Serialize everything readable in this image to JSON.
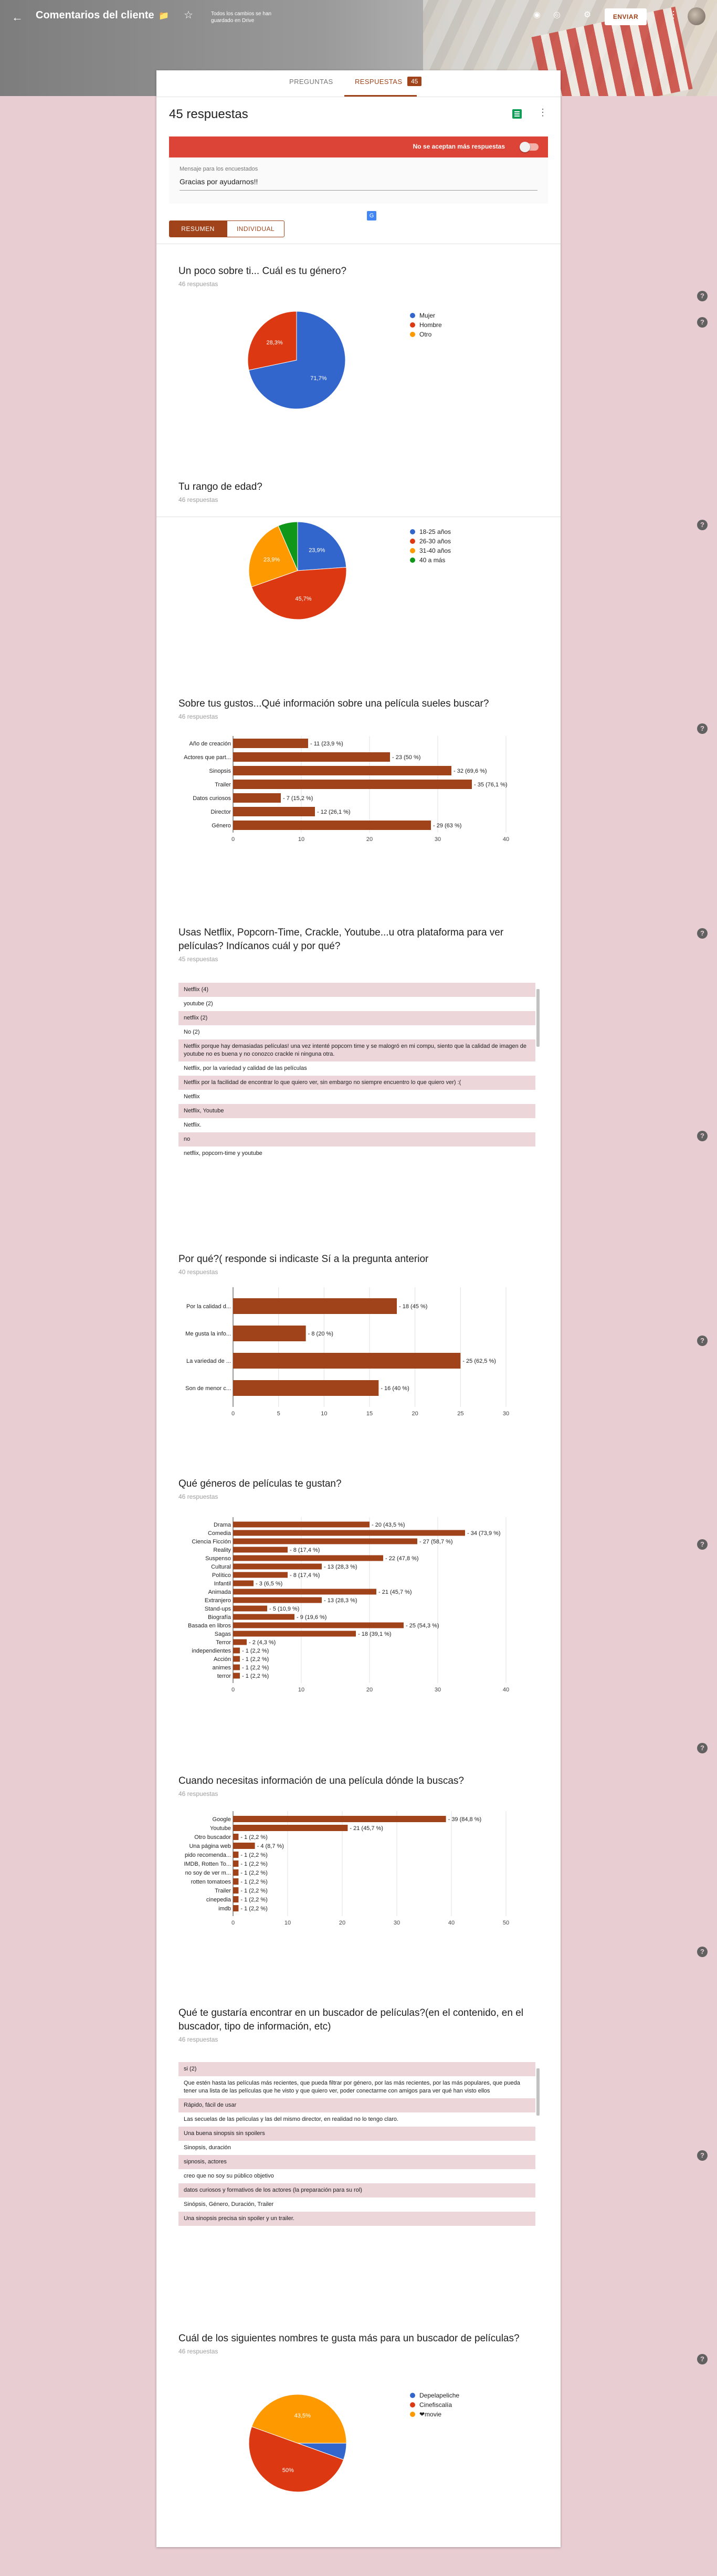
{
  "header": {
    "back_icon": "arrow-back-icon",
    "title": "Comentarios del cliente",
    "save_status": "Todos los cambios se han guardado en Drive",
    "send_label": "ENVIAR"
  },
  "tabs": {
    "preguntas": "PREGUNTAS",
    "respuestas": "RESPUESTAS",
    "badge": "45"
  },
  "summary": {
    "count_label": "45 respuestas",
    "accepting_label": "No se aceptan más respuestas",
    "message_label": "Mensaje para los encuestados",
    "message_value": "Gracias por ayudarnos!!",
    "resumen_label": "RESUMEN",
    "individual_label": "INDIVIDUAL"
  },
  "colors": {
    "accent": "#a0431a",
    "blue": "#3366cc",
    "red": "#dc3912",
    "orange": "#ff9900",
    "green": "#109618",
    "bar": "#a0431a"
  },
  "questions": {
    "q1": {
      "title": "Un poco sobre ti... Cuál es tu género?",
      "count": "46 respuestas"
    },
    "q2": {
      "title": "Tu rango de edad?",
      "count": "46 respuestas"
    },
    "q3": {
      "title": "Sobre tus gustos...Qué información sobre una película sueles buscar?",
      "count": "46 respuestas"
    },
    "q4": {
      "title": "Usas Netflix, Popcorn-Time, Crackle, Youtube...u otra plataforma para ver películas? Indícanos cuál y por qué?",
      "count": "45 respuestas"
    },
    "q5": {
      "title": "Por qué?( responde si indicaste Sí a la pregunta anterior",
      "count": "40 respuestas"
    },
    "q6": {
      "title": "Qué géneros de películas te gustan?",
      "count": "46 respuestas"
    },
    "q7": {
      "title": "Cuando necesitas información de una película dónde la buscas?",
      "count": "46 respuestas"
    },
    "q8": {
      "title": "Qué te gustaría encontrar en un buscador de películas?(en el contenido, en el buscador, tipo de información, etc)",
      "count": "46 respuestas"
    },
    "q9": {
      "title": "Cuál de los siguientes nombres te gusta más para un buscador de películas?",
      "count": "46 respuestas"
    }
  },
  "q4_responses": [
    "Netflix (4)",
    "youtube (2)",
    "netflix (2)",
    "No (2)",
    "Netflix porque hay demasiadas películas! una vez intenté popcorn time y se malogró en mi compu, siento que la calidad de imagen de youtube no es buena y no conozco crackle ni ninguna otra.",
    "Netflix, por la variedad y calidad de las películas",
    "Netflix por la facilidad de encontrar lo que quiero ver, sin embargo no siempre encuentro lo que quiero ver) :(",
    "Netflix",
    "Netflix, Youtube",
    "Netflix.",
    "no",
    "netflix, popcorn-time y youtube"
  ],
  "q8_responses": [
    "si (2)",
    "Que estén hasta las películas más recientes, que pueda filtrar por género, por las más recientes, por las más populares, que pueda tener una lista de las películas que he visto y que quiero ver, poder conectarme con amigos para ver qué han visto ellos",
    "Rápido, fácil de usar",
    "Las secuelas de las películas y las del mismo director, en realidad no lo tengo claro.",
    "Una buena sinopsis sin spoilers",
    "Sinopsis, duración",
    "sipnosis, actores",
    "creo que no soy su público objetivo",
    "datos curiosos y formativos de los actores (la preparación para su rol)",
    "Sinópsis, Género, Duración, Trailer",
    "Una sinopsis precisa sin spoiler y un trailer."
  ],
  "chart_data": [
    {
      "type": "pie",
      "categories": [
        "Mujer",
        "Hombre",
        "Otro"
      ],
      "values": [
        71.7,
        28.3,
        0
      ],
      "slice_labels": [
        "71,7%",
        "28,3%",
        ""
      ],
      "colors": [
        "#3366cc",
        "#dc3912",
        "#ff9900"
      ],
      "legend": "right"
    },
    {
      "type": "pie",
      "categories": [
        "18-25 años",
        "26-30 años",
        "31-40 años",
        "40 a más"
      ],
      "values": [
        23.9,
        45.7,
        23.9,
        6.5
      ],
      "slice_labels": [
        "23,9%",
        "45,7%",
        "23,9%",
        ""
      ],
      "colors": [
        "#3366cc",
        "#dc3912",
        "#ff9900",
        "#109618"
      ],
      "legend": "right"
    },
    {
      "type": "bar",
      "orientation": "horizontal",
      "categories": [
        "Año de creación",
        "Actores que part...",
        "Sinopsis",
        "Trailer",
        "Datos curiosos",
        "Director",
        "Género"
      ],
      "values": [
        11,
        23,
        32,
        35,
        7,
        12,
        29
      ],
      "value_labels": [
        "11 (23,9 %)",
        "23 (50 %)",
        "32 (69,6 %)",
        "35 (76,1 %)",
        "7 (15,2 %)",
        "12 (26,1 %)",
        "29 (63 %)"
      ],
      "xlim": [
        0,
        40
      ],
      "ticks": [
        0,
        10,
        20,
        30,
        40
      ]
    },
    {
      "type": "bar",
      "orientation": "horizontal",
      "categories": [
        "Por la calidad d...",
        "Me gusta la info...",
        "La variedad de ...",
        "Son de menor c..."
      ],
      "values": [
        18,
        8,
        25,
        16
      ],
      "value_labels": [
        "18 (45 %)",
        "8 (20 %)",
        "25 (62,5 %)",
        "16 (40 %)"
      ],
      "xlim": [
        0,
        30
      ],
      "ticks": [
        0,
        5,
        10,
        15,
        20,
        25,
        30
      ]
    },
    {
      "type": "bar",
      "orientation": "horizontal",
      "categories": [
        "Drama",
        "Comedia",
        "Ciencia Ficción",
        "Reality",
        "Suspenso",
        "Cultural",
        "Político",
        "Infantil",
        "Animada",
        "Extranjero",
        "Stand-ups",
        "Biografía",
        "Basada en libros",
        "Sagas",
        "Terror",
        "independientes",
        "Acción",
        "animes",
        "terror"
      ],
      "values": [
        20,
        34,
        27,
        8,
        22,
        13,
        8,
        3,
        21,
        13,
        5,
        9,
        25,
        18,
        2,
        1,
        1,
        1,
        1
      ],
      "value_labels": [
        "20 (43,5 %)",
        "34 (73,9 %)",
        "27 (58,7 %)",
        "8 (17,4 %)",
        "22 (47,8 %)",
        "13 (28,3 %)",
        "8 (17,4 %)",
        "3 (6,5 %)",
        "21 (45,7 %)",
        "13 (28,3 %)",
        "5 (10,9 %)",
        "9 (19,6 %)",
        "25 (54,3 %)",
        "18 (39,1 %)",
        "2 (4,3 %)",
        "1 (2,2 %)",
        "1 (2,2 %)",
        "1 (2,2 %)",
        "1 (2,2 %)"
      ],
      "xlim": [
        0,
        40
      ],
      "ticks": [
        0,
        10,
        20,
        30,
        40
      ]
    },
    {
      "type": "bar",
      "orientation": "horizontal",
      "categories": [
        "Google",
        "Youtube",
        "Otro buscador",
        "Una página web",
        "pido recomenda...",
        "IMDB, Rotten To...",
        "no soy de ver m...",
        "rotten tomatoes",
        "Trailer",
        "cinepedia",
        "imdb"
      ],
      "values": [
        39,
        21,
        1,
        4,
        1,
        1,
        1,
        1,
        1,
        1,
        1
      ],
      "value_labels": [
        "39 (84,8 %)",
        "21 (45,7 %)",
        "1 (2,2 %)",
        "4 (8,7 %)",
        "1 (2,2 %)",
        "1 (2,2 %)",
        "1 (2,2 %)",
        "1 (2,2 %)",
        "1 (2,2 %)",
        "1 (2,2 %)",
        "1 (2,2 %)"
      ],
      "xlim": [
        0,
        50
      ],
      "ticks": [
        0,
        10,
        20,
        30,
        40,
        50
      ]
    },
    {
      "type": "pie",
      "categories": [
        "Depelapeliche",
        "Cinefiscalía",
        "❤movie"
      ],
      "values": [
        5.5,
        50,
        44.5
      ],
      "slice_labels": [
        "",
        "50%",
        "43,5%"
      ],
      "colors": [
        "#3366cc",
        "#dc3912",
        "#ff9900"
      ],
      "legend": "right"
    }
  ]
}
